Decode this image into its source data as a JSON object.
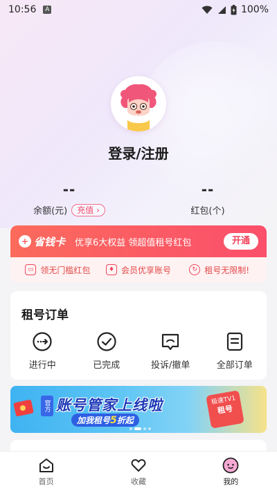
{
  "status_bar": {
    "time": "10:56",
    "app_indicator": "A",
    "battery": "100%",
    "icons": [
      "wifi-icon",
      "signal-icon",
      "battery-charging-icon"
    ]
  },
  "profile": {
    "login_label": "登录/注册",
    "avatar": "lion-mascot-avatar"
  },
  "stats": {
    "balance": {
      "value": "--",
      "label": "余额(元)",
      "action": "充值"
    },
    "red_packets": {
      "value": "--",
      "label": "红包(个)"
    }
  },
  "vip_card": {
    "logo_text": "省钱卡",
    "logo_icon": "+",
    "description": "优享6大权益 领超值租号红包",
    "open_button": "开通",
    "benefits": [
      {
        "label": "领无门槛红包",
        "icon": "coupon-icon"
      },
      {
        "label": "会员优享账号",
        "icon": "member-icon"
      },
      {
        "label": "租号无限制!",
        "icon": "refresh-icon"
      }
    ],
    "accent": "#fb5064"
  },
  "orders": {
    "title": "租号订单",
    "items": [
      {
        "label": "进行中",
        "icon": "in-progress-icon"
      },
      {
        "label": "已完成",
        "icon": "completed-icon"
      },
      {
        "label": "投诉/撤单",
        "icon": "complaint-icon"
      },
      {
        "label": "全部订单",
        "icon": "all-orders-icon"
      }
    ]
  },
  "banner": {
    "tag": "官方",
    "title": "账号管家上线啦",
    "subtitle_prefix": "加我租号",
    "subtitle_highlight": "5",
    "subtitle_suffix": "折起",
    "card_text_line1": "极速TV1",
    "card_text_line2": "租号"
  },
  "tabbar": {
    "items": [
      {
        "label": "首页",
        "icon": "home-icon"
      },
      {
        "label": "收藏",
        "icon": "heart-icon"
      },
      {
        "label": "我的",
        "icon": "profile-face-icon"
      }
    ],
    "active_index": 2
  }
}
